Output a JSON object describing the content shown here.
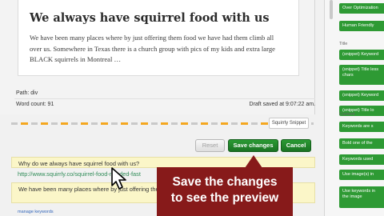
{
  "editor": {
    "title": "We always have squirrel food with us",
    "body": "We have been many places where by just offering them food we have had them climb all over us. Somewhere in Texas there is a church group with pics of my kids and extra large BLACK squirrels in Montreal …",
    "path": "Path: div",
    "word_count": "Word count: 91",
    "draft_saved": "Draft saved at 9:07:22 am."
  },
  "snippet_tab": "Squirrly Snippet",
  "buttons": {
    "reset": "Reset",
    "save": "Save changes",
    "cancel": "Cancel"
  },
  "snippet": {
    "title": "Why do we always have squirrel food with us?",
    "url": "http://www.squirrly.co/squirrel-food-needed-fast",
    "description": "We have been many places where by just offering them food we have had them climb all over us",
    "manage_keywords": "manage keywords"
  },
  "callout": {
    "line1": "Save the changes",
    "line2": "to see the preview"
  },
  "sidebar": {
    "items_top": [
      "Over Optimization",
      "Human Friendly"
    ],
    "head_title": "Title",
    "items_title": [
      "(snippet) Keyword",
      "(snippet) Title less chars",
      "(snippet) Keyword",
      "(snippet) Title lo"
    ],
    "head_content": "Content",
    "items_content": [
      "Keywords are s",
      "Bold one of the",
      "Keywords used",
      "Use image(s) in",
      "Use keywords in the image"
    ]
  },
  "colors": {
    "accent_green": "#2e9a34",
    "callout_red": "#871a1a",
    "highlight_yellow": "#fbf6c8"
  }
}
